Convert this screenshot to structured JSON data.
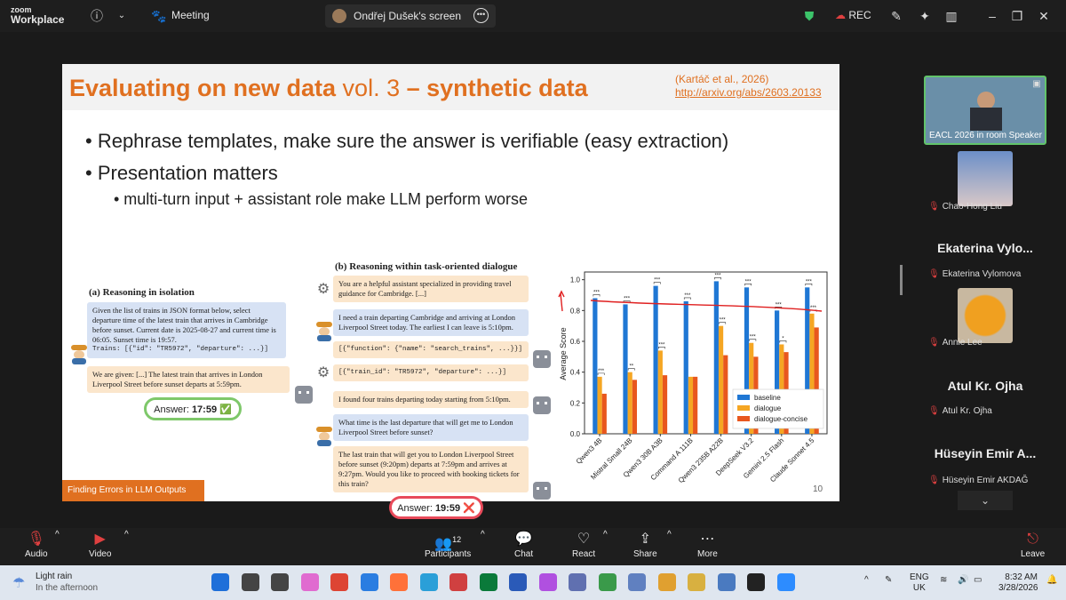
{
  "topbar": {
    "logo_line1": "zoom",
    "logo_line2": "Workplace",
    "info_icon": "info-icon",
    "meeting_label": "Meeting",
    "screen_label": "Ondřej Dušek's screen",
    "rec_label": "REC"
  },
  "slide": {
    "title_main": "Evaluating on new data",
    "title_vol": " vol. 3",
    "title_dash": " – synthetic data",
    "cite_line1": "(Kartáč et al., 2026)",
    "cite_line2": "http://arxiv.org/abs/2603.20133",
    "bullet1": "• Rephrase templates, make sure the answer is verifiable (easy extraction)",
    "bullet2": "• Presentation matters",
    "sub_bullet1": "• multi-turn input + assistant role make LLM perform worse",
    "footer": "Finding Errors in LLM Outputs",
    "page_number": "10",
    "panel_a": {
      "title": "(a)  Reasoning in isolation",
      "user_text": "Given the list of trains in JSON format below, select departure time of the latest train that arrives in Cambridge before sunset. Current date is 2025-08-27 and current time is 06:05. Sunset time is 19:57.",
      "user_code": "Trains: [{\"id\": \"TR5972\", \"departure\": ...}]",
      "assistant_text": "We are given: [...] The latest train that arrives in London Liverpool Street before sunset departs at 5:59pm.",
      "answer_label": "Answer: ",
      "answer_value": "17:59",
      "answer_mark": "✅"
    },
    "panel_b": {
      "title": "(b)  Reasoning within task-oriented dialogue",
      "system_text": "You are a helpful assistant specialized in providing travel guidance for Cambridge. [...]",
      "user1": "I need a train departing Cambridge and arriving at London Liverpool Street today. The earliest I can leave is 5:10pm.",
      "function_call": "[{\"function\": {\"name\": \"search_trains\", ...}}]",
      "tool_result": "[{\"train_id\": \"TR5972\", \"departure\": ...}]",
      "assistant1": "I found four trains departing today starting from 5:10pm.",
      "user2": "What time is the last departure that will get me to London Liverpool Street before sunset?",
      "assistant2": "The last train that will get you to London Liverpool Street before sunset (9:20pm) departs at 7:59pm and arrives at 9:27pm. Would you like to proceed with booking tickets for this train?",
      "answer_label": "Answer: ",
      "answer_value": "19:59",
      "answer_mark": "❌"
    }
  },
  "chart_data": {
    "type": "bar",
    "ylabel": "Average Score",
    "ylim": [
      0,
      1.05
    ],
    "yticks": [
      "0.0",
      "0.2",
      "0.4",
      "0.6",
      "0.8",
      "1.0"
    ],
    "categories": [
      "Qwen3 4B",
      "Mistral Small 24B",
      "Qwen3 30B A3B",
      "Command A 111B",
      "Qwen3 235B A22B",
      "DeepSeek V3.2",
      "Gemini 2.5 Flash",
      "Claude Sonnet 4.5"
    ],
    "series": [
      {
        "name": "baseline",
        "color": "#1f77d4",
        "values": [
          0.88,
          0.84,
          0.96,
          0.86,
          0.99,
          0.95,
          0.8,
          0.95
        ]
      },
      {
        "name": "dialogue",
        "color": "#f5a623",
        "values": [
          0.37,
          0.4,
          0.54,
          0.37,
          0.7,
          0.59,
          0.58,
          0.78
        ]
      },
      {
        "name": "dialogue-concise",
        "color": "#e8571e",
        "values": [
          0.26,
          0.35,
          0.38,
          0.37,
          0.51,
          0.5,
          0.53,
          0.69
        ]
      }
    ],
    "significance": [
      [
        "***",
        "***"
      ],
      [
        "***",
        "**"
      ],
      [
        "***",
        "***"
      ],
      [
        "***",
        ""
      ],
      [
        "***",
        "***"
      ],
      [
        "***",
        "***"
      ],
      [
        "***",
        "*"
      ],
      [
        "***",
        "***"
      ]
    ],
    "legend_position": "bottom-right",
    "grid": false
  },
  "participants": [
    {
      "name": "EACL 2026 in room Speaker",
      "muted": false
    },
    {
      "name": "Chao-Hong Liu",
      "muted": true
    },
    {
      "big": "Ekaterina  Vylo...",
      "name": "Ekaterina Vylomova",
      "muted": true
    },
    {
      "name": "Annie Lee",
      "muted": true
    },
    {
      "big": "Atul Kr. Ojha",
      "name": "Atul Kr. Ojha",
      "muted": true
    },
    {
      "big": "Hüseyin Emir A...",
      "name": "Hüseyin Emir AKDAĞ",
      "muted": true
    }
  ],
  "toolbar": {
    "audio": "Audio",
    "video": "Video",
    "participants": "Participants",
    "participants_count": "12",
    "chat": "Chat",
    "react": "React",
    "share": "Share",
    "more": "More",
    "leave": "Leave"
  },
  "taskbar": {
    "weather_title": "Light rain",
    "weather_sub": "In the afternoon",
    "lang1": "ENG",
    "lang2": "UK",
    "time": "8:32 AM",
    "date": "3/28/2026",
    "app_colors": [
      "#1e6fd9",
      "#444",
      "#444",
      "#e06bd0",
      "#dd4433",
      "#2a7de1",
      "#ff7139",
      "#2a9fd8",
      "#d04040",
      "#0a7a3a",
      "#2a5ab8",
      "#b050e0",
      "#6070b0",
      "#3a9a4a",
      "#6080c0",
      "#e0a030",
      "#d8b040",
      "#4a7ac0",
      "#222",
      "#2d8cff"
    ]
  }
}
